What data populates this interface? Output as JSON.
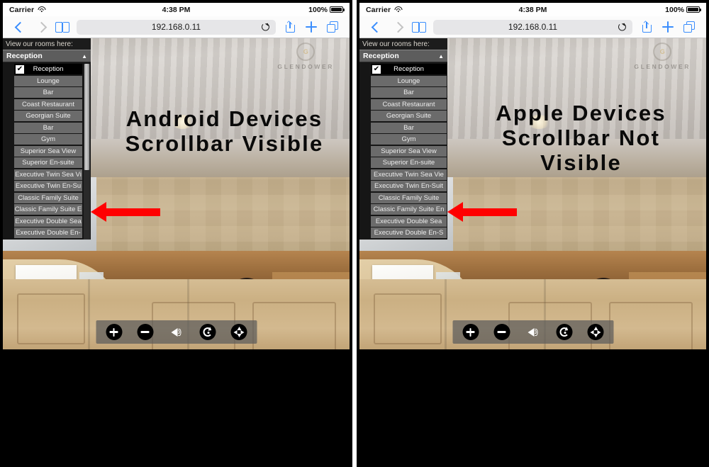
{
  "colors": {
    "accent_ios_blue": "#3a8dfd",
    "arrow_red": "#ff0000",
    "list_item_bg": "#6b6b6b",
    "list_selected_bg": "#000000",
    "scrollbar_thumb": "#b5b5b5"
  },
  "panels": [
    {
      "id": "android",
      "statusbar": {
        "carrier": "Carrier",
        "wifi_icon": "wifi-icon",
        "time": "4:38 PM",
        "battery_percent": "100%",
        "battery_icon": "battery-full-icon"
      },
      "browser": {
        "back_icon": "chevron-left-icon",
        "forward_icon": "chevron-right-icon",
        "bookmarks_icon": "book-icon",
        "url": "192.168.0.11",
        "reload_icon": "reload-icon",
        "share_icon": "share-icon",
        "newtab_icon": "plus-icon",
        "tabs_icon": "tabs-icon"
      },
      "roomlist": {
        "header": "View our rooms here:",
        "selected": "Reception",
        "caret_icon": "caret-up-icon",
        "check_icon": "✔",
        "scrollbar_visible": true,
        "items": [
          "Reception",
          "Lounge",
          "Bar",
          "Coast Restaurant",
          "Georgian Suite",
          "Bar",
          "Gym",
          "Superior Sea View",
          "Superior En-suite",
          "Executive Twin Sea Vi",
          "Executive Twin En-Su",
          "Classic Family Suite",
          "Classic Family Suite E",
          "Executive Double Sea",
          "Executive Double En-"
        ]
      },
      "caption": "Android Devices Scrollbar Visible",
      "watermark": {
        "logo_icon": "glendower-crest-icon",
        "text": "GLENDOWER"
      },
      "mediabar": {
        "buttons": [
          "zoom-in-icon",
          "zoom-out-icon",
          "speaker-icon",
          "refresh-icon",
          "pan-move-icon"
        ]
      }
    },
    {
      "id": "apple",
      "statusbar": {
        "carrier": "Carrier",
        "wifi_icon": "wifi-icon",
        "time": "4:38 PM",
        "battery_percent": "100%",
        "battery_icon": "battery-full-icon"
      },
      "browser": {
        "back_icon": "chevron-left-icon",
        "forward_icon": "chevron-right-icon",
        "bookmarks_icon": "book-icon",
        "url": "192.168.0.11",
        "reload_icon": "reload-icon",
        "share_icon": "share-icon",
        "newtab_icon": "plus-icon",
        "tabs_icon": "tabs-icon"
      },
      "roomlist": {
        "header": "View our rooms here:",
        "selected": "Reception",
        "caret_icon": "caret-up-icon",
        "check_icon": "✔",
        "scrollbar_visible": false,
        "items": [
          "Reception",
          "Lounge",
          "Bar",
          "Coast Restaurant",
          "Georgian Suite",
          "Bar",
          "Gym",
          "Superior Sea View",
          "Superior En-suite",
          "Executive Twin Sea Vie",
          "Executive Twin En-Suit",
          "Classic Family Suite",
          "Classic Family Suite En",
          "Executive Double Sea",
          "Executive Double En-S"
        ]
      },
      "caption": "Apple Devices Scrollbar Not Visible",
      "watermark": {
        "logo_icon": "glendower-crest-icon",
        "text": "GLENDOWER"
      },
      "mediabar": {
        "buttons": [
          "zoom-in-icon",
          "zoom-out-icon",
          "speaker-icon",
          "refresh-icon",
          "pan-move-icon"
        ]
      }
    }
  ]
}
